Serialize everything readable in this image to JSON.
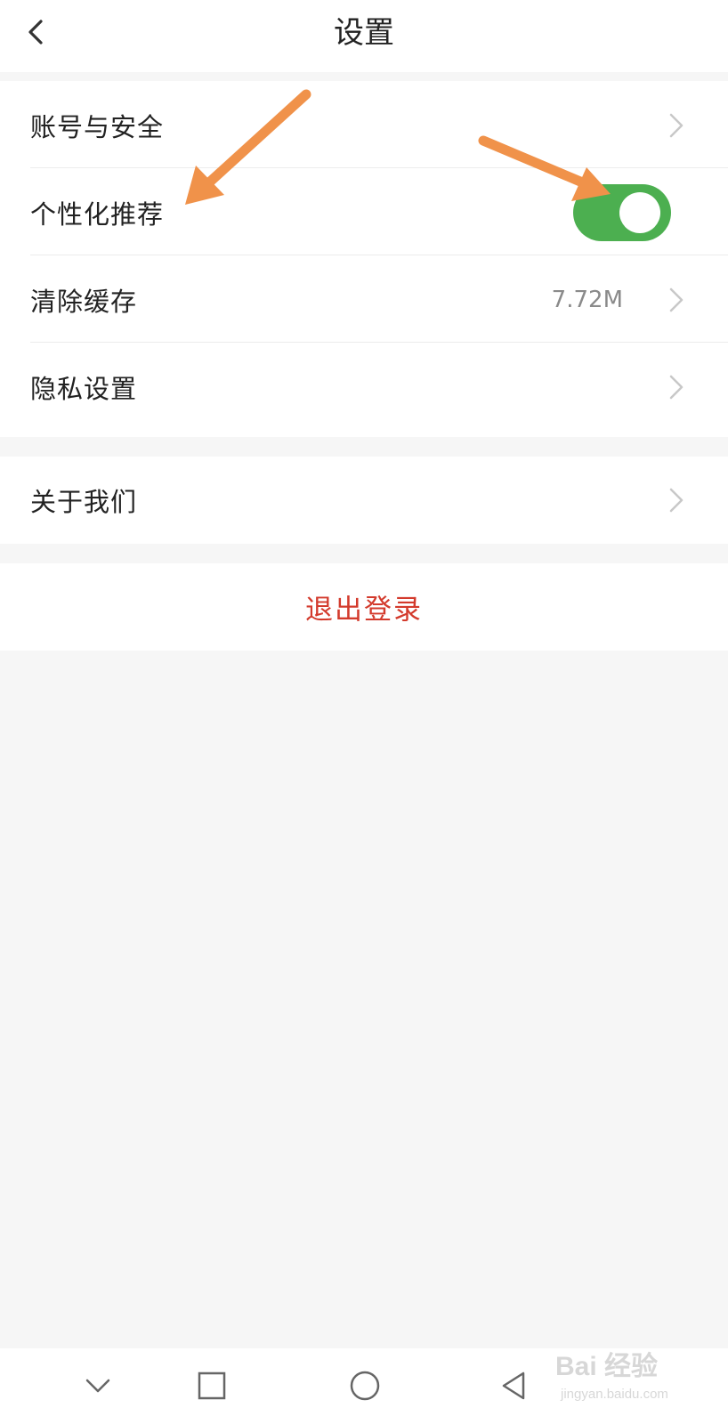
{
  "header": {
    "title": "设置",
    "back_icon": "chevron-left-icon"
  },
  "settings": {
    "account_security": "账号与安全",
    "personalized_recommendation": "个性化推荐",
    "personalized_recommendation_enabled": true,
    "clear_cache": "清除缓存",
    "cache_size": "7.72M",
    "privacy_settings": "隐私设置"
  },
  "about": {
    "label": "关于我们"
  },
  "logout": {
    "label": "退出登录"
  },
  "nav": {
    "icons": [
      "chevron-down-icon",
      "square-icon",
      "circle-icon",
      "triangle-back-icon"
    ]
  },
  "watermark": {
    "main": "Bai 经验",
    "sub": "jingyan.baidu.com"
  },
  "colors": {
    "toggle_on": "#4caf50",
    "logout_text": "#d33a2c",
    "annotation_arrow": "#f0924a"
  }
}
